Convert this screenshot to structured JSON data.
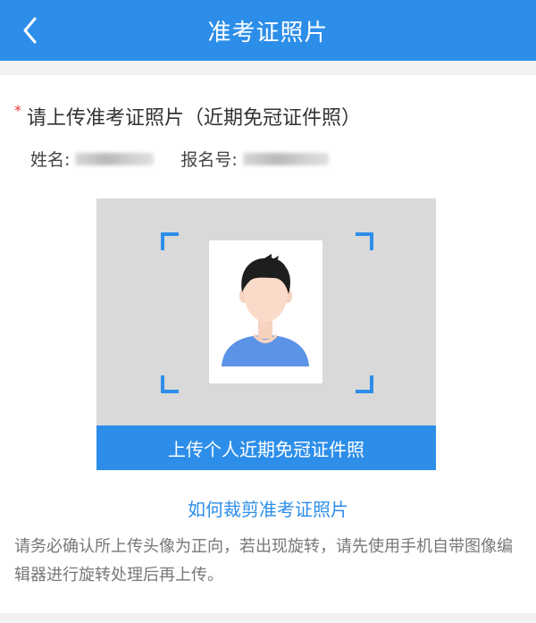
{
  "header": {
    "title": "准考证照片"
  },
  "form": {
    "title": "请上传准考证照片（近期免冠证件照）",
    "required_mark": "*",
    "name_label": "姓名:",
    "exam_no_label": "报名号:"
  },
  "upload": {
    "button_label": "上传个人近期免冠证件照"
  },
  "help": {
    "crop_link": "如何裁剪准考证照片",
    "tip": "请务必确认所上传头像为正向，若出现旋转，请先使用手机自带图像编辑器进行旋转处理后再上传。"
  },
  "colors": {
    "primary": "#2d8ee9",
    "required": "#e53935"
  },
  "icons": {
    "back": "chevron-left-icon",
    "avatar": "person-avatar-icon"
  }
}
